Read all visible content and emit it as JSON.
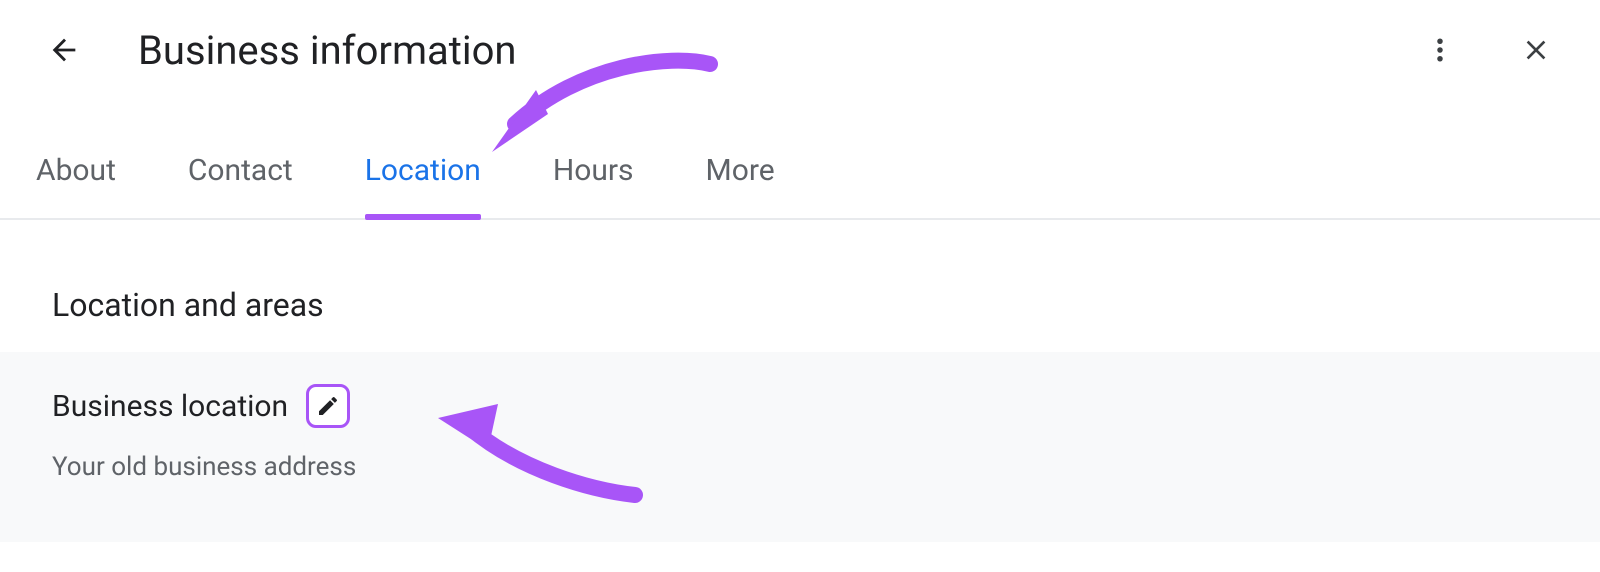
{
  "header": {
    "title": "Business information"
  },
  "tabs": [
    {
      "label": "About",
      "active": false
    },
    {
      "label": "Contact",
      "active": false
    },
    {
      "label": "Location",
      "active": true
    },
    {
      "label": "Hours",
      "active": false
    },
    {
      "label": "More",
      "active": false
    }
  ],
  "section": {
    "heading": "Location and areas",
    "item_title": "Business location",
    "item_subtitle": "Your old business address"
  },
  "colors": {
    "accent_blue": "#1a73e8",
    "annotation_purple": "#a855f7",
    "text_secondary": "#5f6368"
  },
  "icons": {
    "back": "arrow-left",
    "more_vert": "more-vert",
    "close": "close",
    "edit": "pencil"
  }
}
